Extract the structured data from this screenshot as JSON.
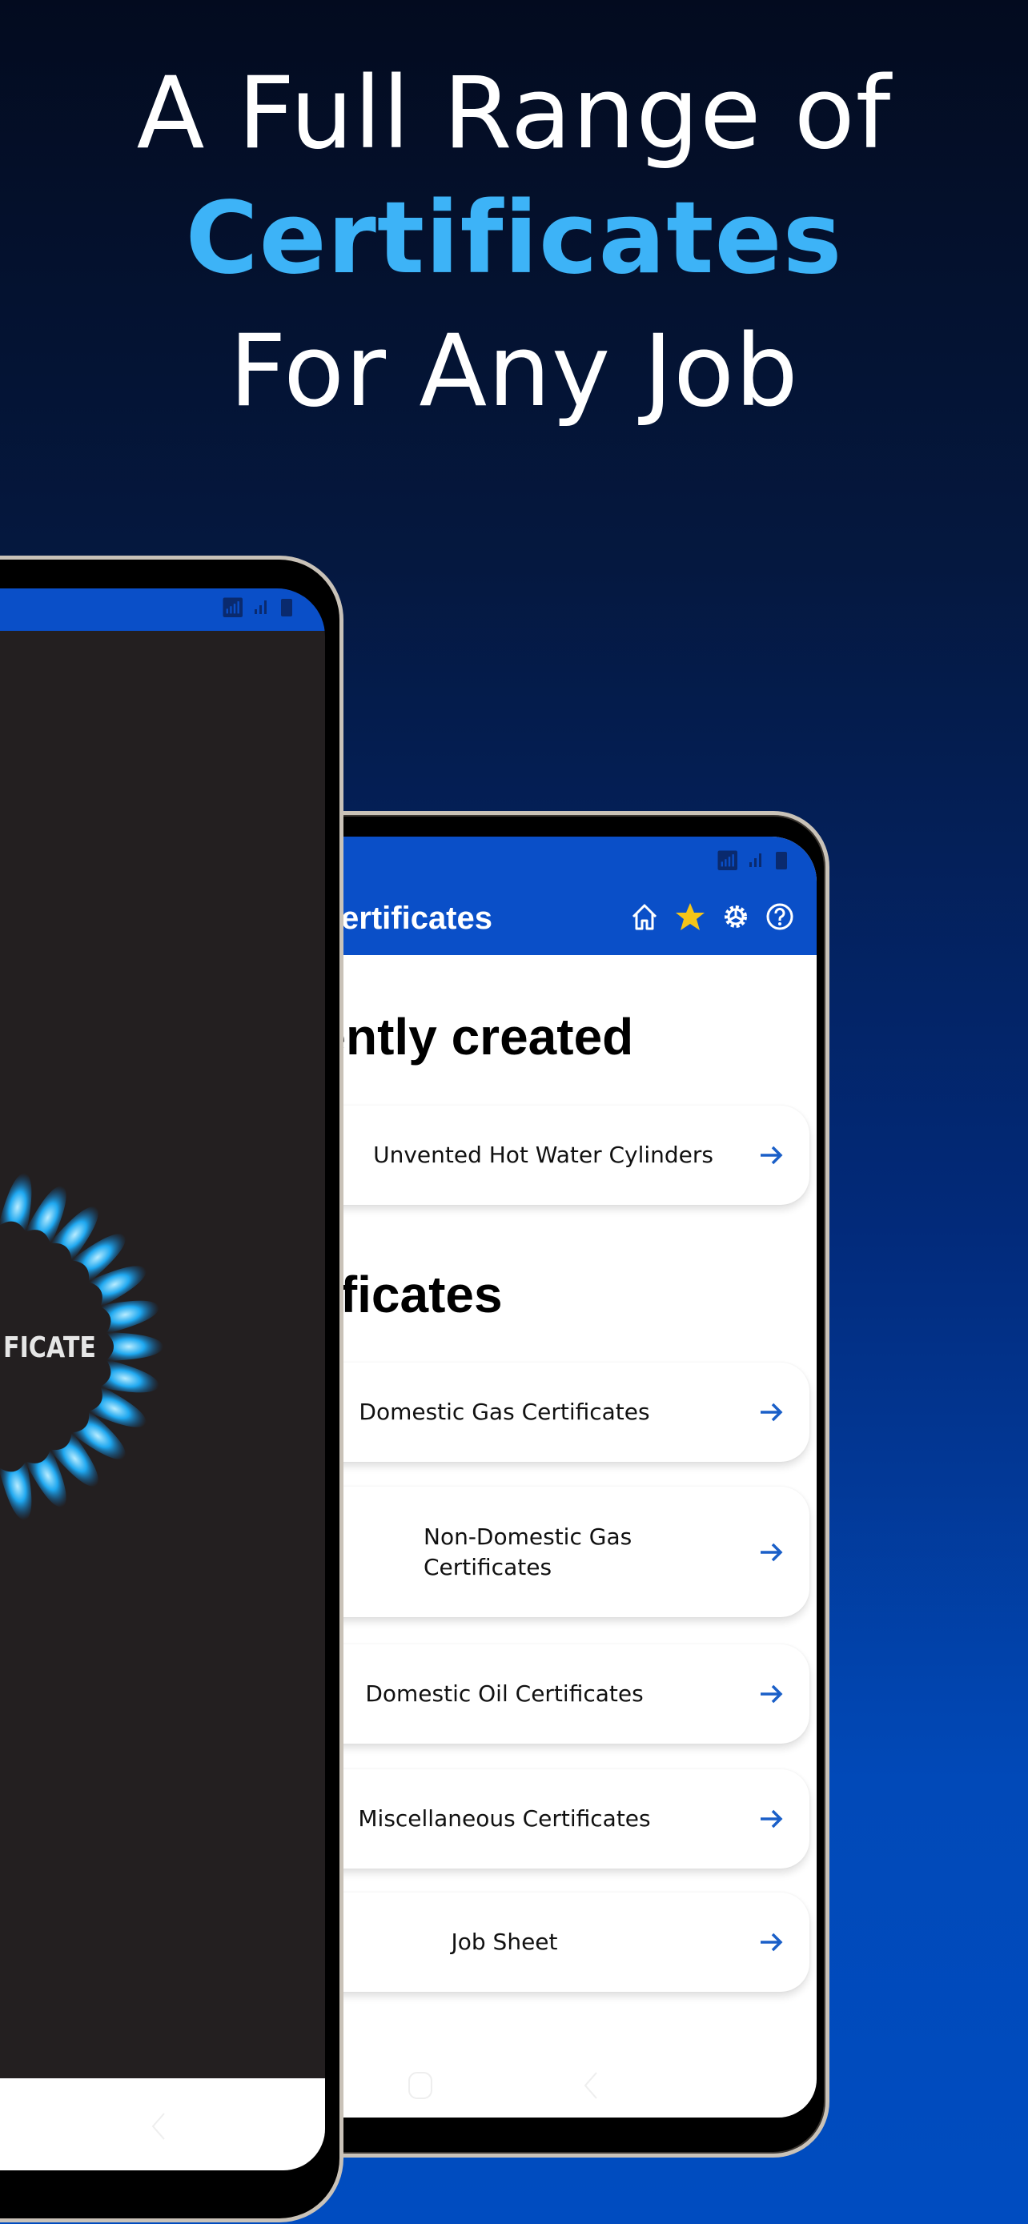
{
  "headline": {
    "line1": "A Full Range of",
    "line2": "Certificates",
    "line3": "For Any Job"
  },
  "colors": {
    "accent": "#3db3f7",
    "app_bar": "#0a4fc8",
    "star": "#f5c518",
    "arrow": "#1a5fc8",
    "splash_bg": "#231f20",
    "flame": "#1fa8f0"
  },
  "left_phone": {
    "status_icons": [
      "wifi-icon",
      "signal-icon",
      "battery-icon"
    ],
    "logo_text": "CERTIFICATE"
  },
  "right_phone": {
    "status_icons": [
      "wifi-icon",
      "signal-icon",
      "battery-icon"
    ],
    "app_title": "Certificates",
    "header_icons": [
      "home-icon",
      "star-icon",
      "gear-icon",
      "help-icon"
    ],
    "recent": {
      "heading": "Recently created",
      "items": [
        {
          "label": "Unvented Hot Water Cylinders"
        }
      ]
    },
    "certificates": {
      "heading": "Certificates",
      "items": [
        {
          "label": "Domestic Gas Certificates"
        },
        {
          "label": "Non-Domestic Gas Certificates"
        },
        {
          "label": "Domestic Oil Certificates"
        },
        {
          "label": "Miscellaneous Certificates"
        },
        {
          "label": "Job Sheet"
        }
      ]
    }
  }
}
